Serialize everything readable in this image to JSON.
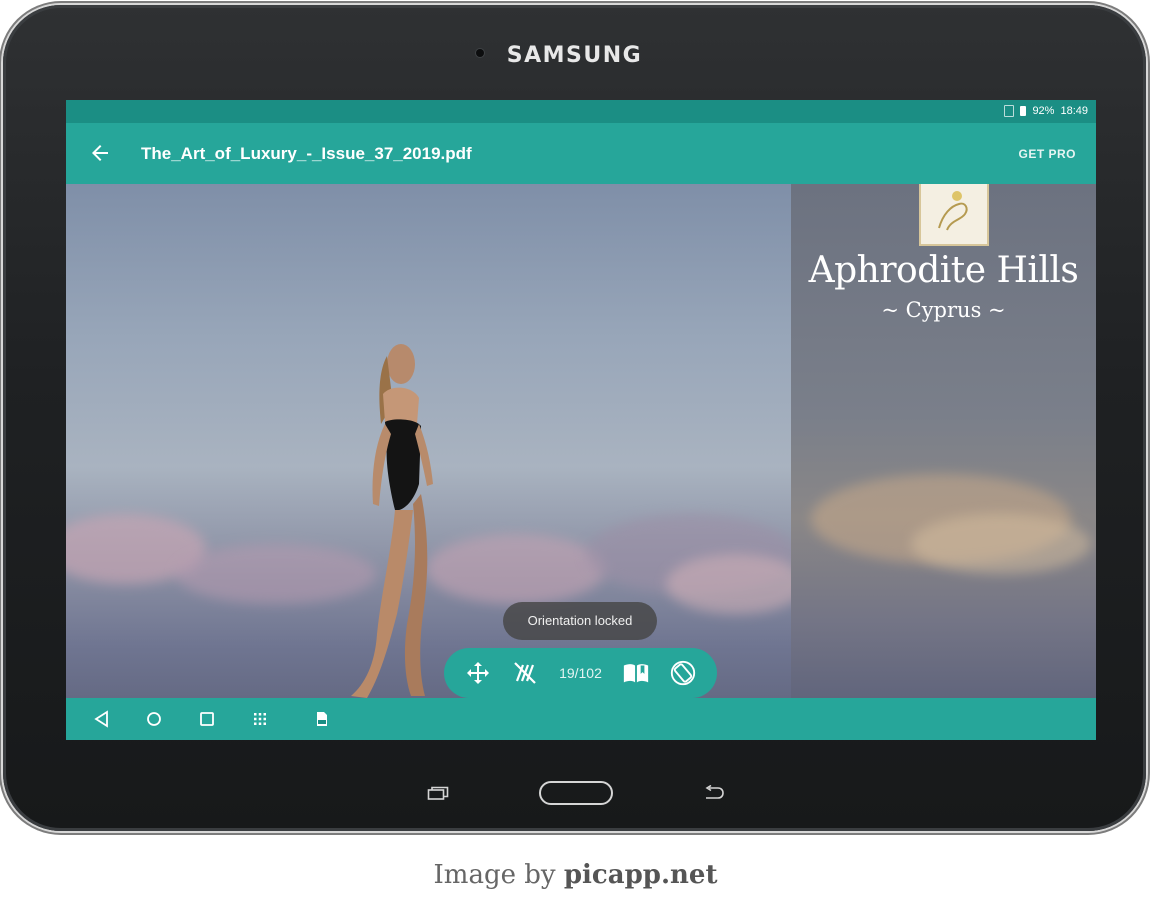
{
  "device": {
    "brand": "SAMSUNG"
  },
  "status_bar": {
    "battery": "92%",
    "time": "18:49"
  },
  "app_bar": {
    "title": "The_Art_of_Luxury_-_Issue_37_2019.pdf",
    "get_pro_label": "GET PRO",
    "back_icon": "arrow-left-icon"
  },
  "page": {
    "logo_title": "Aphrodite Hills",
    "logo_subtitle": "~ Cyprus ~"
  },
  "toast": {
    "text": "Orientation locked"
  },
  "toolbar": {
    "page_counter": "19/102",
    "icons": [
      "move-icon",
      "auto-scroll-off-icon",
      "book-icon",
      "rotate-icon"
    ]
  },
  "caption": {
    "prefix": "Image by",
    "site": "picapp.net"
  },
  "colors": {
    "accent": "#26a69a",
    "status_bar": "#1b8e84"
  }
}
